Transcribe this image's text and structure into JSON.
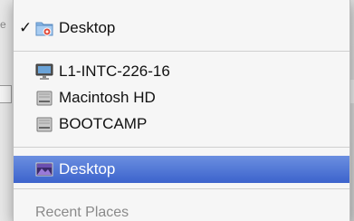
{
  "background": {
    "left_fragment": "e"
  },
  "menu": {
    "current": {
      "checkmark": "✓",
      "label": "Desktop",
      "icon": "desktop-folder-icon"
    },
    "devices": [
      {
        "label": "L1-INTC-226-16",
        "icon": "computer-icon"
      },
      {
        "label": "Macintosh HD",
        "icon": "hard-drive-icon"
      },
      {
        "label": "BOOTCAMP",
        "icon": "hard-drive-icon"
      }
    ],
    "places": [
      {
        "label": "Desktop",
        "icon": "desktop-icon",
        "selected": true
      }
    ],
    "recent_header": "Recent Places"
  },
  "colors": {
    "selection": "#3c63cc",
    "menu_bg": "#f6f6f6"
  }
}
